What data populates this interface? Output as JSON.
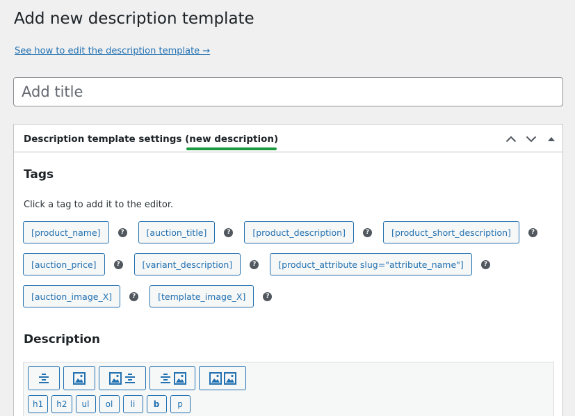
{
  "page": {
    "title": "Add new description template",
    "help_link": "See how to edit the description template →",
    "title_placeholder": "Add title"
  },
  "postbox": {
    "title_prefix": "Description template settings ",
    "title_highlight": "(new description)",
    "tags_heading": "Tags",
    "tags_help": "Click a tag to add it to the editor.",
    "tag_rows": [
      [
        "[product_name]",
        "[auction_title]",
        "[product_description]",
        "[product_short_description]"
      ],
      [
        "[auction_price]",
        "[variant_description]",
        "[product_attribute slug=\"attribute_name\"]"
      ],
      [
        "[auction_image_X]",
        "[template_image_X]"
      ]
    ],
    "description_heading": "Description",
    "layout_buttons": [
      "align-center-icon",
      "image-icon",
      "image-text-icon",
      "text-image-icon",
      "two-images-icon"
    ],
    "format_buttons": [
      "h1",
      "h2",
      "ul",
      "ol",
      "li",
      "b",
      "p"
    ]
  },
  "colors": {
    "accent": "#2271b1",
    "highlight_underline": "#1b9a3f",
    "background": "#f0f0f1"
  }
}
